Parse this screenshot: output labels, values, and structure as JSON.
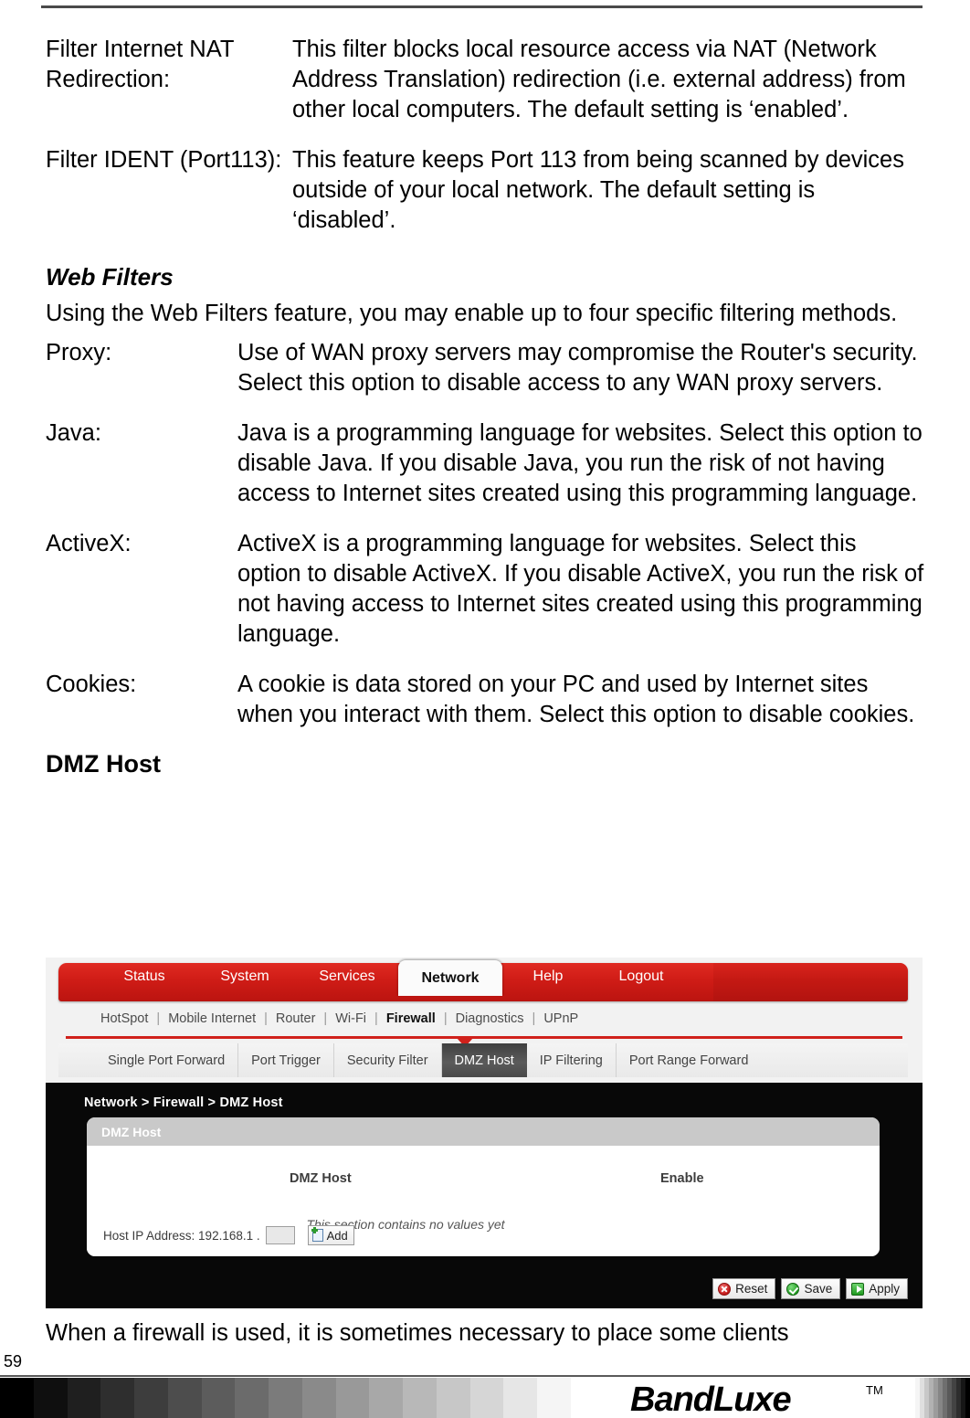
{
  "document": {
    "definitions_group_1": [
      {
        "term": "Filter Internet NAT Redirection:",
        "description": "This filter blocks local resource access via NAT (Network Address Translation) redirection (i.e. external address) from other local computers. The default setting is ‘enabled’."
      },
      {
        "term": "Filter IDENT (Port113):",
        "description": "This feature keeps Port 113 from being scanned by devices outside of your local network. The default setting is ‘disabled’."
      }
    ],
    "web_filters_heading": "Web Filters",
    "web_filters_intro": "Using the Web Filters feature, you may enable up to four specific filtering methods.",
    "definitions_group_2": [
      {
        "term": "Proxy:",
        "description": "Use of WAN proxy servers may compromise the Router's security. Select this option to disable access to any WAN proxy servers."
      },
      {
        "term": "Java:",
        "description": "Java is a programming language for websites. Select this option to disable Java. If you disable Java, you run the risk of not having access to Internet sites created using this programming language."
      },
      {
        "term": "ActiveX:",
        "description": "ActiveX is a programming language for websites. Select this option to disable ActiveX. If you disable ActiveX, you run the risk of not having access to Internet sites created using this programming language."
      },
      {
        "term": "Cookies:",
        "description": "A cookie is data stored on your PC and used by Internet sites when you interact with them. Select this option to disable cookies."
      }
    ],
    "dmz_host_heading": "DMZ Host",
    "caption_after_figure": "When a firewall is used, it is sometimes necessary to place some clients",
    "page_number": "59"
  },
  "screenshot": {
    "primary_nav": [
      {
        "label": "Status",
        "active": false
      },
      {
        "label": "System",
        "active": false
      },
      {
        "label": "Services",
        "active": false
      },
      {
        "label": "Network",
        "active": true
      },
      {
        "label": "Help",
        "active": false
      },
      {
        "label": "Logout",
        "active": false
      }
    ],
    "secondary_nav": [
      {
        "label": "HotSpot",
        "active": false
      },
      {
        "label": "Mobile Internet",
        "active": false
      },
      {
        "label": "Router",
        "active": false
      },
      {
        "label": "Wi-Fi",
        "active": false
      },
      {
        "label": "Firewall",
        "active": true
      },
      {
        "label": "Diagnostics",
        "active": false
      },
      {
        "label": "UPnP",
        "active": false
      }
    ],
    "tertiary_nav": [
      {
        "label": "Single Port Forward",
        "active": false
      },
      {
        "label": "Port Trigger",
        "active": false
      },
      {
        "label": "Security Filter",
        "active": false
      },
      {
        "label": "DMZ Host",
        "active": true
      },
      {
        "label": "IP Filtering",
        "active": false
      },
      {
        "label": "Port Range Forward",
        "active": false
      }
    ],
    "breadcrumb": "Network > Firewall > DMZ Host",
    "panel": {
      "title": "DMZ Host",
      "column_headers": [
        "DMZ Host",
        "Enable"
      ],
      "empty_message": "This section contains no values yet",
      "host_ip_label": "Host IP Address: 192.168.1 .",
      "host_ip_value": "",
      "host_ip_placeholder": "",
      "add_button_label": "Add"
    },
    "actions": [
      {
        "label": "Reset",
        "icon": "reset-icon"
      },
      {
        "label": "Save",
        "icon": "save-icon"
      },
      {
        "label": "Apply",
        "icon": "apply-icon"
      }
    ],
    "colors": {
      "nav_red": "#cf1c16",
      "active_tab_dark": "#4a4a4a",
      "panel_header_gray": "#c9c9c9",
      "body_black": "#080808"
    }
  },
  "footer": {
    "brand": "BandLuxe",
    "trademark": "TM"
  }
}
